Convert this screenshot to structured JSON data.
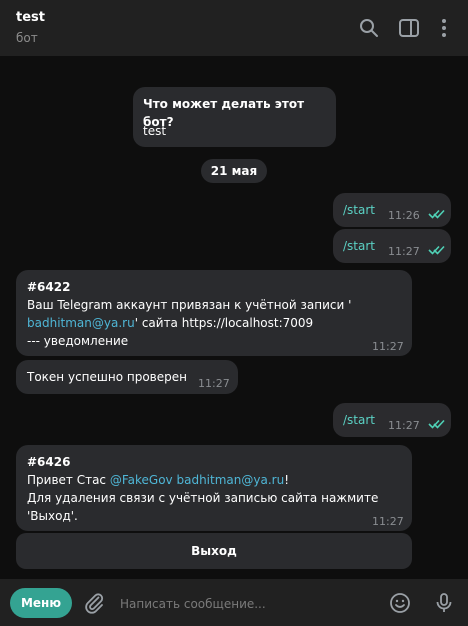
{
  "header": {
    "title": "test",
    "subtitle": "бот"
  },
  "intro": {
    "title": "Что может делать этот бот?",
    "text": "test"
  },
  "date_separator": "21 мая",
  "messages": [
    {
      "text": "/start",
      "time": "11:26"
    },
    {
      "text": "/start",
      "time": "11:27"
    },
    {
      "line1": "#6422",
      "line2": "Ваш Telegram аккаунт привязан к учётной записи '",
      "link": "badhitman@ya.ru",
      "line3_rest": "' сайта https://localhost:7009",
      "line4": "--- уведомление",
      "time": "11:27"
    },
    {
      "text": "Токен успешно проверен",
      "time": "11:27"
    },
    {
      "text": "/start",
      "time": "11:27"
    },
    {
      "line1": "#6426",
      "greet_prefix": "Привет Стас ",
      "mention": "@FakeGov",
      "space": " ",
      "email": "badhitman@ya.ru",
      "excl": "!",
      "line3": "Для удаления связи с учётной записью сайта нажмите",
      "line4": "'Выход'.",
      "time": "11:27"
    }
  ],
  "inline_button": "Выход",
  "composer": {
    "menu_label": "Меню",
    "placeholder": "Написать сообщение..."
  },
  "colors": {
    "accent": "#34a392",
    "link": "#4fb6d6",
    "command": "#5bd1c4",
    "tick": "#4fd1b6"
  },
  "icons": [
    "search-icon",
    "sidebar-toggle-icon",
    "more-icon",
    "attach-icon",
    "emoji-icon",
    "mic-icon",
    "double-check-icon"
  ]
}
